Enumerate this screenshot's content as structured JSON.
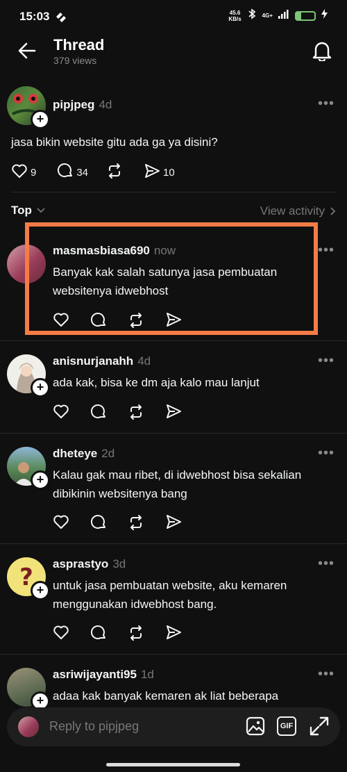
{
  "status": {
    "time": "15:03",
    "net_speed": "45.6",
    "net_unit": "KB/s",
    "network": "4G+",
    "battery": "25"
  },
  "header": {
    "title": "Thread",
    "views": "379 views"
  },
  "post": {
    "username": "pipjpeg",
    "time": "4d",
    "text": "jasa bikin website gitu ada ga ya disini?",
    "likes": "9",
    "comments": "34",
    "shares": "10"
  },
  "sort": {
    "label": "Top",
    "view_activity": "View activity"
  },
  "replies": [
    {
      "username": "masmasbiasa690",
      "time": "now",
      "text": "Banyak kak salah satunya jasa pembuatan websitenya idwebhost"
    },
    {
      "username": "anisnurjanahh",
      "time": "4d",
      "text": "ada kak, bisa ke dm aja kalo mau lanjut"
    },
    {
      "username": "dheteye",
      "time": "2d",
      "text": "Kalau gak mau ribet, di idwebhost bisa sekalian dibikinin websitenya bang"
    },
    {
      "username": "asprastyo",
      "time": "3d",
      "text": "untuk jasa pembuatan website, aku kemaren menggunakan idwebhost bang."
    },
    {
      "username": "asriwijayanti95",
      "time": "1d",
      "text": "adaa kak banyak kemaren ak liat beberapa"
    }
  ],
  "reply_bar": {
    "placeholder": "Reply to pipjpeg",
    "gif_label": "GIF"
  },
  "colors": {
    "background": "#101010",
    "highlight": "#f57c46",
    "text": "#f3f5f7",
    "muted": "#777777",
    "battery": "#7cc576"
  }
}
